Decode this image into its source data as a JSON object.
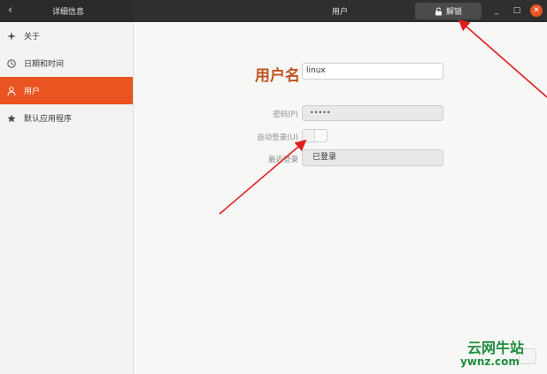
{
  "header": {
    "left_title": "详细信息",
    "center_title": "用户",
    "unlock_label": "解锁",
    "minimize_glyph": "_",
    "maximize_glyph": "□",
    "close_glyph": "✕",
    "back_glyph": "‹"
  },
  "sidebar": {
    "items": [
      {
        "label": "关于",
        "icon": "star-burst-icon"
      },
      {
        "label": "日期和时间",
        "icon": "clock-icon"
      },
      {
        "label": "用户",
        "icon": "person-icon"
      },
      {
        "label": "默认应用程序",
        "icon": "star-icon"
      }
    ],
    "active_index": 2
  },
  "main": {
    "username_label": "用户名",
    "username_value": "linux",
    "password_label": "密码(P)",
    "password_value": "•••••",
    "autologin_label": "自动登录(U)",
    "autologin_on": false,
    "last_login_label": "最近登录",
    "last_login_value": "已登录"
  },
  "watermark": {
    "cn": "云网牛站",
    "en": "ywnz.com"
  },
  "colors": {
    "accent": "#e95420",
    "username_label": "#c0531f",
    "arrow": "#e02020",
    "watermark": "#1e8e3e"
  }
}
